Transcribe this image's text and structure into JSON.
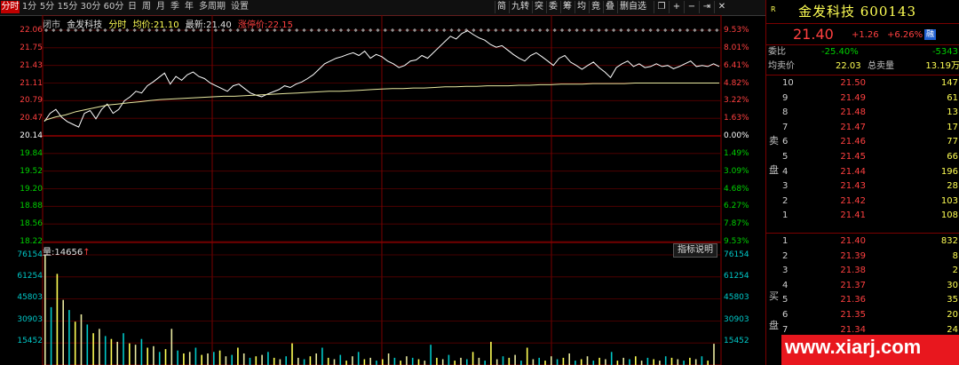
{
  "toolbar": {
    "periods": [
      "分时",
      "1分",
      "5分",
      "15分",
      "30分",
      "60分",
      "日",
      "周",
      "月",
      "季",
      "年",
      "多周期",
      "设置"
    ],
    "active_period": "分时",
    "tools": [
      "简",
      "九转",
      "突",
      "委",
      "筹",
      "均",
      "竟",
      "叠",
      "删自选"
    ],
    "icons": [
      "copy-icon",
      "plus-icon",
      "minus-icon",
      "pin-icon",
      "close-icon"
    ]
  },
  "chart_info": {
    "status": "闭市",
    "name": "金发科技",
    "mode": "分时",
    "avg_label": "均价:",
    "avg_value": "21.10",
    "latest_label": "最新:",
    "latest_value": "21.40",
    "limit_label": "涨停价:",
    "limit_value": "22.15"
  },
  "price_axis": {
    "left": [
      "22.06",
      "21.75",
      "21.43",
      "21.11",
      "20.79",
      "20.47",
      "20.14",
      "19.84",
      "19.52",
      "19.20",
      "18.88",
      "18.56",
      "18.22"
    ],
    "right": [
      "9.53%",
      "8.01%",
      "6.41%",
      "4.82%",
      "3.22%",
      "1.63%",
      "0.00%",
      "1.49%",
      "3.09%",
      "4.68%",
      "6.27%",
      "7.87%",
      "9.53%"
    ]
  },
  "volume_panel": {
    "label": "量:",
    "value": "14656",
    "indicator_button": "指标说明",
    "axis": [
      "76154",
      "61254",
      "45803",
      "30903",
      "15452"
    ]
  },
  "panel": {
    "title": "金发科技 600143",
    "r_tag": "R",
    "price": "21.40",
    "change": "+1.26",
    "change_pct": "+6.26%",
    "badge": "融",
    "commission_label": "委比",
    "commission_pct": "-25.40%",
    "commission_diff": "-5343",
    "avg_label": "均卖价",
    "avg_value": "22.03",
    "total_label": "总卖量",
    "total_value": "13.19万",
    "sell_side_label": [
      "卖",
      "盘"
    ],
    "buy_side_label": [
      "买",
      "盘"
    ],
    "sell": [
      {
        "level": "10",
        "price": "21.50",
        "vol": "147"
      },
      {
        "level": "9",
        "price": "21.49",
        "vol": "61"
      },
      {
        "level": "8",
        "price": "21.48",
        "vol": "13"
      },
      {
        "level": "7",
        "price": "21.47",
        "vol": "17"
      },
      {
        "level": "6",
        "price": "21.46",
        "vol": "77"
      },
      {
        "level": "5",
        "price": "21.45",
        "vol": "66"
      },
      {
        "level": "4",
        "price": "21.44",
        "vol": "196"
      },
      {
        "level": "3",
        "price": "21.43",
        "vol": "28"
      },
      {
        "level": "2",
        "price": "21.42",
        "vol": "103"
      },
      {
        "level": "1",
        "price": "21.41",
        "vol": "108"
      }
    ],
    "buy": [
      {
        "level": "1",
        "price": "21.40",
        "vol": "832"
      },
      {
        "level": "2",
        "price": "21.39",
        "vol": "8"
      },
      {
        "level": "3",
        "price": "21.38",
        "vol": "2"
      },
      {
        "level": "4",
        "price": "21.37",
        "vol": "30"
      },
      {
        "level": "5",
        "price": "21.36",
        "vol": "35"
      },
      {
        "level": "6",
        "price": "21.35",
        "vol": "20"
      },
      {
        "level": "7",
        "price": "21.34",
        "vol": "24"
      }
    ]
  },
  "watermark": "www.xiarj.com",
  "colors": {
    "up": "#ff4040",
    "down": "#00d000",
    "grid": "#8a0000",
    "price_line": "#ffffff",
    "avg_line": "#e8e8a0",
    "accent": "#ffff54"
  },
  "series": {
    "price": [
      20.4,
      20.55,
      20.62,
      20.48,
      20.4,
      20.35,
      20.3,
      20.55,
      20.6,
      20.45,
      20.62,
      20.72,
      20.55,
      20.62,
      20.78,
      20.85,
      20.95,
      20.92,
      21.05,
      21.12,
      21.2,
      21.28,
      21.08,
      21.22,
      21.15,
      21.25,
      21.3,
      21.22,
      21.18,
      21.1,
      21.05,
      21.0,
      20.95,
      21.05,
      21.08,
      21.0,
      20.92,
      20.88,
      20.85,
      20.9,
      20.94,
      20.98,
      21.05,
      21.02,
      21.08,
      21.12,
      21.18,
      21.25,
      21.35,
      21.45,
      21.5,
      21.55,
      21.58,
      21.62,
      21.65,
      21.6,
      21.68,
      21.55,
      21.62,
      21.58,
      21.5,
      21.45,
      21.38,
      21.42,
      21.5,
      21.52,
      21.6,
      21.55,
      21.65,
      21.75,
      21.85,
      21.95,
      21.9,
      22.0,
      22.05,
      21.98,
      21.92,
      21.88,
      21.8,
      21.75,
      21.78,
      21.7,
      21.62,
      21.55,
      21.5,
      21.6,
      21.65,
      21.58,
      21.5,
      21.42,
      21.55,
      21.6,
      21.48,
      21.42,
      21.35,
      21.42,
      21.48,
      21.38,
      21.3,
      21.2,
      21.38,
      21.45,
      21.5,
      21.4,
      21.45,
      21.38,
      21.4,
      21.45,
      21.4,
      21.42,
      21.36,
      21.4,
      21.45,
      21.5,
      21.4,
      21.42,
      21.4,
      21.45,
      21.4
    ],
    "avg": [
      20.42,
      20.48,
      20.52,
      20.58,
      20.62,
      20.66,
      20.7,
      20.72,
      20.74,
      20.76,
      20.78,
      20.8,
      20.81,
      20.82,
      20.83,
      20.84,
      20.85,
      20.86,
      20.86,
      20.87,
      20.88,
      20.89,
      20.9,
      20.91,
      20.92,
      20.93,
      20.94,
      20.95,
      20.95,
      20.96,
      20.97,
      20.98,
      20.99,
      21.0,
      21.0,
      21.01,
      21.01,
      21.02,
      21.03,
      21.03,
      21.04,
      21.04,
      21.05,
      21.05,
      21.05,
      21.06,
      21.06,
      21.07,
      21.07,
      21.08,
      21.08,
      21.08,
      21.09,
      21.09,
      21.09,
      21.09,
      21.1,
      21.1,
      21.1,
      21.1,
      21.1,
      21.1,
      21.1,
      21.1,
      21.1
    ],
    "volume": [
      76154,
      40000,
      63000,
      45000,
      38000,
      30000,
      35000,
      28000,
      22000,
      25000,
      20000,
      18000,
      16000,
      22000,
      15000,
      14000,
      18000,
      12000,
      13000,
      9000,
      11000,
      25000,
      10000,
      8000,
      9000,
      12000,
      7000,
      8000,
      9000,
      10000,
      6000,
      7000,
      12000,
      8000,
      5000,
      6000,
      7000,
      9000,
      5000,
      4000,
      6000,
      15000,
      5000,
      4000,
      6000,
      8000,
      12000,
      5000,
      4000,
      7000,
      3000,
      6000,
      9000,
      4000,
      5000,
      3000,
      4000,
      8000,
      5000,
      3000,
      6000,
      5000,
      4000,
      3000,
      14000,
      5000,
      4000,
      7000,
      3000,
      5000,
      4000,
      9000,
      5000,
      3000,
      16000,
      4000,
      6000,
      5000,
      7000,
      3000,
      12000,
      4000,
      5000,
      3000,
      6000,
      4000,
      5000,
      8000,
      3000,
      4000,
      6000,
      3000,
      5000,
      4000,
      9000,
      3000,
      5000,
      4000,
      6000,
      3000,
      5000,
      4000,
      3000,
      6000,
      5000,
      4000,
      3000,
      5000,
      4000,
      6000,
      3000,
      14656
    ]
  }
}
